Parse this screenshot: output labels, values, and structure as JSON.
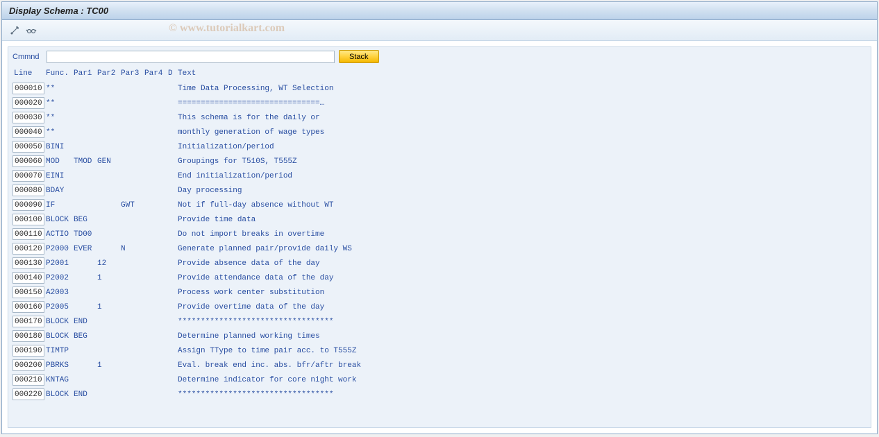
{
  "title": "Display Schema : TC00",
  "watermark": "© www.tutorialkart.com",
  "command": {
    "label": "Cmmnd",
    "value": "",
    "stack_label": "Stack"
  },
  "headers": {
    "line": "Line",
    "func": "Func.",
    "par1": "Par1",
    "par2": "Par2",
    "par3": "Par3",
    "par4": "Par4",
    "d": "D",
    "text": "Text"
  },
  "rows": [
    {
      "line": "000010",
      "func": "**",
      "par1": "",
      "par2": "",
      "par3": "",
      "par4": "",
      "d": "",
      "text": "Time Data Processing, WT Selection"
    },
    {
      "line": "000020",
      "func": "**",
      "par1": "",
      "par2": "",
      "par3": "",
      "par4": "",
      "d": "",
      "text": "===============================…"
    },
    {
      "line": "000030",
      "func": "**",
      "par1": "",
      "par2": "",
      "par3": "",
      "par4": "",
      "d": "",
      "text": "This schema is for the daily or"
    },
    {
      "line": "000040",
      "func": "**",
      "par1": "",
      "par2": "",
      "par3": "",
      "par4": "",
      "d": "",
      "text": "monthly generation of wage types"
    },
    {
      "line": "000050",
      "func": "BINI",
      "par1": "",
      "par2": "",
      "par3": "",
      "par4": "",
      "d": "",
      "text": "Initialization/period"
    },
    {
      "line": "000060",
      "func": "MOD",
      "par1": "TMOD",
      "par2": "GEN",
      "par3": "",
      "par4": "",
      "d": "",
      "text": "Groupings for T510S, T555Z"
    },
    {
      "line": "000070",
      "func": "EINI",
      "par1": "",
      "par2": "",
      "par3": "",
      "par4": "",
      "d": "",
      "text": "End initialization/period"
    },
    {
      "line": "000080",
      "func": "BDAY",
      "par1": "",
      "par2": "",
      "par3": "",
      "par4": "",
      "d": "",
      "text": "Day processing"
    },
    {
      "line": "000090",
      "func": "IF",
      "par1": "",
      "par2": "",
      "par3": "GWT",
      "par4": "",
      "d": "",
      "text": "Not if full-day absence without WT"
    },
    {
      "line": "000100",
      "func": "BLOCK",
      "par1": "BEG",
      "par2": "",
      "par3": "",
      "par4": "",
      "d": "",
      "text": "Provide time data"
    },
    {
      "line": "000110",
      "func": "ACTIO",
      "par1": "TD00",
      "par2": "",
      "par3": "",
      "par4": "",
      "d": "",
      "text": "Do not import breaks in overtime"
    },
    {
      "line": "000120",
      "func": "P2000",
      "par1": "EVER",
      "par2": "",
      "par3": "N",
      "par4": "",
      "d": "",
      "text": "Generate planned pair/provide daily WS"
    },
    {
      "line": "000130",
      "func": "P2001",
      "par1": "",
      "par2": "12",
      "par3": "",
      "par4": "",
      "d": "",
      "text": "Provide absence data of the day"
    },
    {
      "line": "000140",
      "func": "P2002",
      "par1": "",
      "par2": "1",
      "par3": "",
      "par4": "",
      "d": "",
      "text": "Provide attendance data of the day"
    },
    {
      "line": "000150",
      "func": "A2003",
      "par1": "",
      "par2": "",
      "par3": "",
      "par4": "",
      "d": "",
      "text": "Process work center substitution"
    },
    {
      "line": "000160",
      "func": "P2005",
      "par1": "",
      "par2": "1",
      "par3": "",
      "par4": "",
      "d": "",
      "text": "Provide overtime data of the day"
    },
    {
      "line": "000170",
      "func": "BLOCK",
      "par1": "END",
      "par2": "",
      "par3": "",
      "par4": "",
      "d": "",
      "text": "**********************************"
    },
    {
      "line": "000180",
      "func": "BLOCK",
      "par1": "BEG",
      "par2": "",
      "par3": "",
      "par4": "",
      "d": "",
      "text": "Determine planned working times"
    },
    {
      "line": "000190",
      "func": "TIMTP",
      "par1": "",
      "par2": "",
      "par3": "",
      "par4": "",
      "d": "",
      "text": "Assign TType to time pair acc. to T555Z"
    },
    {
      "line": "000200",
      "func": "PBRKS",
      "par1": "",
      "par2": "1",
      "par3": "",
      "par4": "",
      "d": "",
      "text": "Eval. break end inc. abs. bfr/aftr break"
    },
    {
      "line": "000210",
      "func": "KNTAG",
      "par1": "",
      "par2": "",
      "par3": "",
      "par4": "",
      "d": "",
      "text": "Determine indicator for core night work"
    },
    {
      "line": "000220",
      "func": "BLOCK",
      "par1": "END",
      "par2": "",
      "par3": "",
      "par4": "",
      "d": "",
      "text": "**********************************"
    }
  ]
}
